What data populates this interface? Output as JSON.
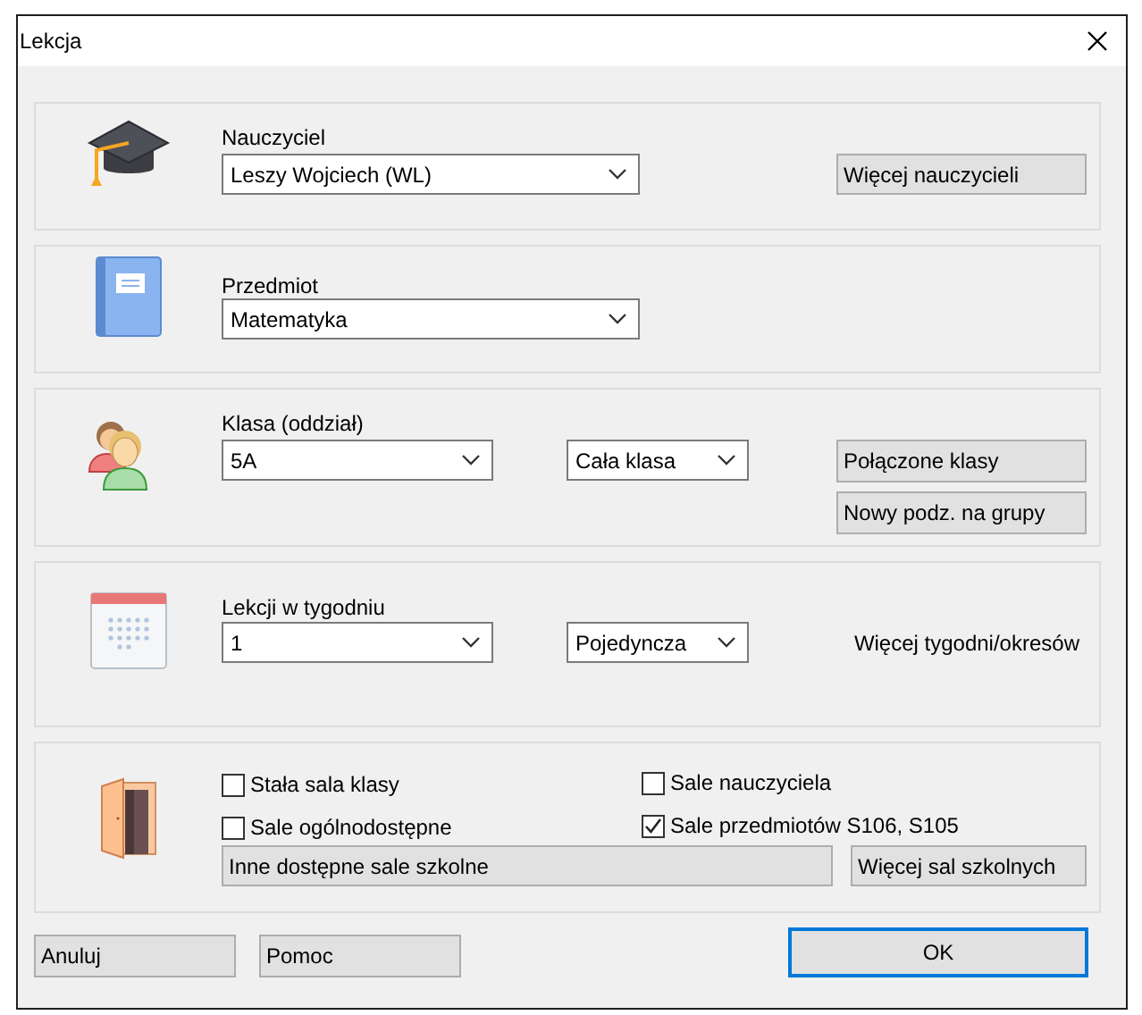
{
  "window": {
    "title": "Lekcja"
  },
  "teacher": {
    "label": "Nauczyciel",
    "value": "Leszy Wojciech (WL)",
    "button": "Więcej nauczycieli"
  },
  "subject": {
    "label": "Przedmiot",
    "value": "Matematyka"
  },
  "class": {
    "label": "Klasa (oddział)",
    "value": "5A",
    "division": "Cała klasa",
    "buttons": [
      "Połączone klasy",
      "Nowy podz. na grupy"
    ]
  },
  "lessons": {
    "label": "Lekcji w tygodniu",
    "value": "1",
    "type": "Pojedyncza",
    "link": "Więcej tygodni/okresów"
  },
  "rooms": {
    "checkboxes": [
      {
        "label": "Stała sala klasy",
        "checked": false
      },
      {
        "label": "Sale ogólnodostępne",
        "checked": false
      },
      {
        "label": "Sale nauczyciela",
        "checked": false
      },
      {
        "label": "Sale przedmiotów S106, S105",
        "checked": true
      }
    ],
    "field": "Inne dostępne sale szkolne",
    "button": "Więcej sal szkolnych"
  },
  "buttons": [
    {
      "label": "Anuluj",
      "default": false
    },
    {
      "label": "Pomoc",
      "default": false
    },
    {
      "label": "OK",
      "default": true
    }
  ]
}
